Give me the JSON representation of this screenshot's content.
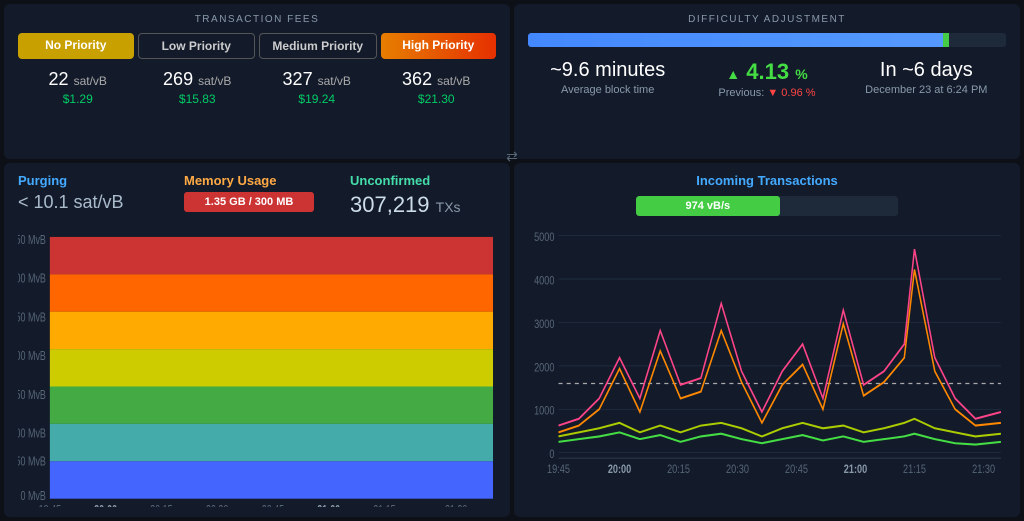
{
  "txFees": {
    "title": "TRANSACTION FEES",
    "tabs": [
      {
        "label": "No Priority",
        "class": "tab-no"
      },
      {
        "label": "Low Priority",
        "class": "tab-low"
      },
      {
        "label": "Medium Priority",
        "class": "tab-med"
      },
      {
        "label": "High Priority",
        "class": "tab-high"
      }
    ],
    "fees": [
      {
        "sat": "22",
        "unit": "sat/vB",
        "usd": "$1.29"
      },
      {
        "sat": "269",
        "unit": "sat/vB",
        "usd": "$15.83"
      },
      {
        "sat": "327",
        "unit": "sat/vB",
        "usd": "$19.24"
      },
      {
        "sat": "362",
        "unit": "sat/vB",
        "usd": "$21.30"
      }
    ]
  },
  "difficulty": {
    "title": "DIFFICULTY ADJUSTMENT",
    "barPercent": 88,
    "avgBlockTime": "~9.6 minutes",
    "avgBlockLabel": "Average block time",
    "changeValue": "4.13",
    "changeUnit": "%",
    "prevLabel": "Previous:",
    "prevValue": "0.96",
    "prevUnit": "%",
    "inDays": "In ~6 days",
    "date": "December 23 at 6:24 PM"
  },
  "mempool": {
    "purging": {
      "label": "Purging",
      "value": "< 10.1 sat/vB"
    },
    "memory": {
      "label": "Memory Usage",
      "bar": "1.35 GB / 300 MB"
    },
    "unconfirmed": {
      "label": "Unconfirmed",
      "value": "307,219",
      "unit": "TXs"
    }
  },
  "incoming": {
    "title": "Incoming Transactions",
    "barLabel": "974 vB/s",
    "barPercent": 55
  },
  "xAxisLabels": [
    "19:45",
    "20:00",
    "20:15",
    "20:30",
    "20:45",
    "21:00",
    "21:15",
    "21:30"
  ],
  "boldLabels": [
    "20:00",
    "21:00"
  ]
}
